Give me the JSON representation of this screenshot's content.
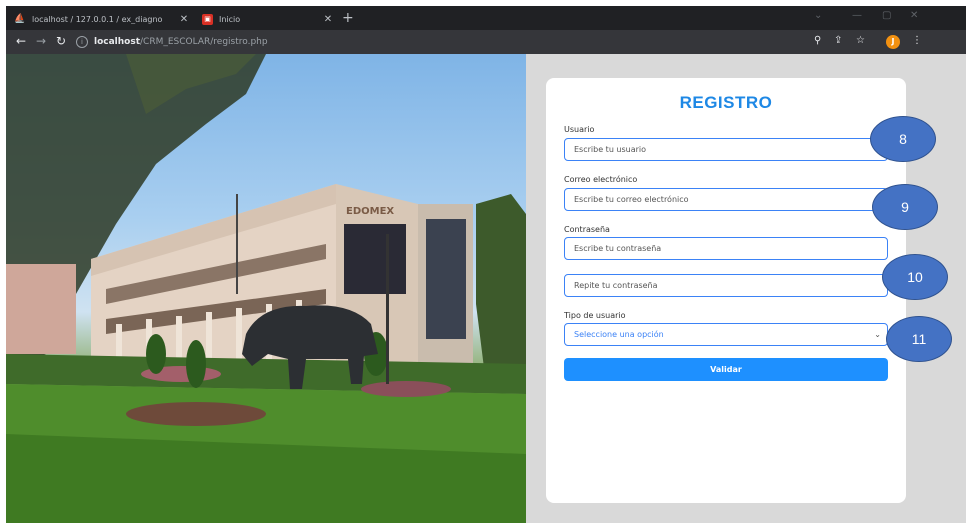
{
  "browser": {
    "tabs": [
      {
        "title": "localhost / 127.0.0.1 / ex_diagno"
      },
      {
        "title": "Inicio"
      }
    ],
    "url_host": "localhost",
    "url_path": "/CRM_ESCOLAR/registro.php",
    "profile_initial": "J"
  },
  "form": {
    "title": "REGISTRO",
    "usuario": {
      "label": "Usuario",
      "placeholder": "Escribe tu usuario"
    },
    "correo": {
      "label": "Correo electrónico",
      "placeholder": "Escribe tu correo electrónico"
    },
    "contrasena": {
      "label": "Contraseña",
      "placeholder": "Escribe tu contraseña"
    },
    "repite": {
      "placeholder": "Repite tu contraseña"
    },
    "tipo": {
      "label": "Tipo de usuario",
      "selected": "Seleccione una opción"
    },
    "submit_label": "Validar"
  },
  "callouts": [
    "8",
    "9",
    "10",
    "11"
  ],
  "photo_sign": "EDOMEX",
  "colors": {
    "accent": "#1e88e5",
    "button": "#1e90ff",
    "callout": "#4472c4"
  }
}
